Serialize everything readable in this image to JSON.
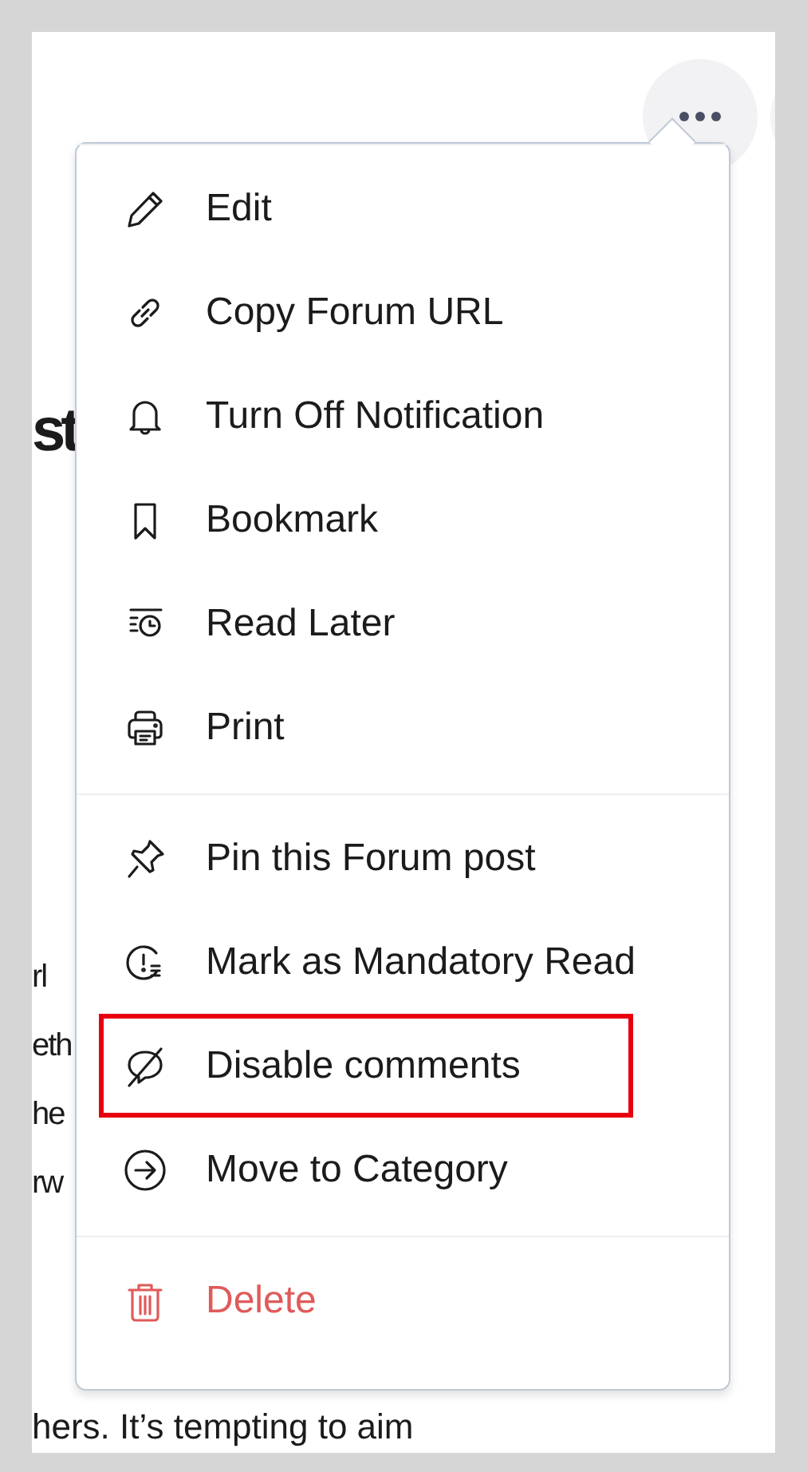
{
  "background": {
    "heading": "st",
    "lines": [
      "rl",
      "eth",
      "he",
      "rw"
    ],
    "last_line": "hers. It’s tempting to aim"
  },
  "menu": {
    "sections": [
      {
        "items": [
          {
            "label": "Edit",
            "kind": "normal",
            "highlighted": false
          },
          {
            "label": "Copy Forum URL",
            "kind": "normal",
            "highlighted": false
          },
          {
            "label": "Turn Off Notification",
            "kind": "normal",
            "highlighted": false
          },
          {
            "label": "Bookmark",
            "kind": "normal",
            "highlighted": false
          },
          {
            "label": "Read Later",
            "kind": "normal",
            "highlighted": false
          },
          {
            "label": "Print",
            "kind": "normal",
            "highlighted": false
          }
        ]
      },
      {
        "items": [
          {
            "label": "Pin this Forum post",
            "kind": "normal",
            "highlighted": false
          },
          {
            "label": "Mark as Mandatory Read",
            "kind": "normal",
            "highlighted": false
          },
          {
            "label": "Disable comments",
            "kind": "normal",
            "highlighted": true
          },
          {
            "label": "Move to Category",
            "kind": "normal",
            "highlighted": false
          }
        ]
      },
      {
        "items": [
          {
            "label": "Delete",
            "kind": "danger",
            "highlighted": false
          }
        ]
      }
    ]
  }
}
